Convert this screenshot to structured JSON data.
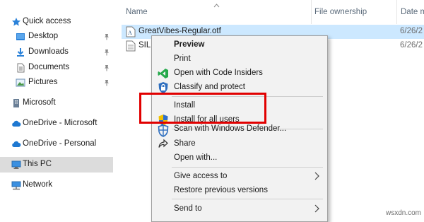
{
  "nav": {
    "items": [
      {
        "label": "Quick access",
        "icon": "star-icon"
      },
      {
        "label": "Desktop",
        "icon": "desktop-folder-icon"
      },
      {
        "label": "Downloads",
        "icon": "downloads-folder-icon"
      },
      {
        "label": "Documents",
        "icon": "documents-folder-icon"
      },
      {
        "label": "Pictures",
        "icon": "pictures-folder-icon"
      },
      {
        "label": "Microsoft",
        "icon": "building-icon"
      },
      {
        "label": "OneDrive - Microsoft",
        "icon": "cloud-icon"
      },
      {
        "label": "OneDrive - Personal",
        "icon": "cloud-icon"
      },
      {
        "label": "This PC",
        "icon": "computer-icon"
      },
      {
        "label": "Network",
        "icon": "network-icon"
      }
    ]
  },
  "columns": {
    "name": "Name",
    "ownership": "File ownership",
    "date": "Date m"
  },
  "files": [
    {
      "name": "GreatVibes-Regular.otf",
      "date": "6/26/2",
      "icon": "font-file-icon",
      "selected": true
    },
    {
      "name": "SIL",
      "date": "6/26/2",
      "icon": "text-file-icon",
      "selected": false
    }
  ],
  "context_menu": {
    "items": [
      {
        "label": "Preview",
        "bold": true,
        "icon": ""
      },
      {
        "label": "Print",
        "icon": ""
      },
      {
        "label": "Open with Code Insiders",
        "icon": "code-insiders-icon"
      },
      {
        "label": "Classify and protect",
        "icon": "lock-shield-icon"
      },
      {
        "label": "Install",
        "icon": ""
      },
      {
        "label": "Install for all users",
        "icon": "uac-shield-icon"
      },
      {
        "label": "Scan with Windows Defender...",
        "icon": "defender-icon"
      },
      {
        "label": "Share",
        "icon": "share-icon"
      },
      {
        "label": "Open with...",
        "icon": ""
      },
      {
        "label": "Give access to",
        "icon": "",
        "submenu": true
      },
      {
        "label": "Restore previous versions",
        "icon": ""
      },
      {
        "label": "Send to",
        "icon": "",
        "submenu": true
      }
    ]
  },
  "colors": {
    "highlight_box": "#e10000",
    "selection": "#cce8ff",
    "folder_blue": "#3a8fe0"
  },
  "watermark": "wsxdn.com"
}
